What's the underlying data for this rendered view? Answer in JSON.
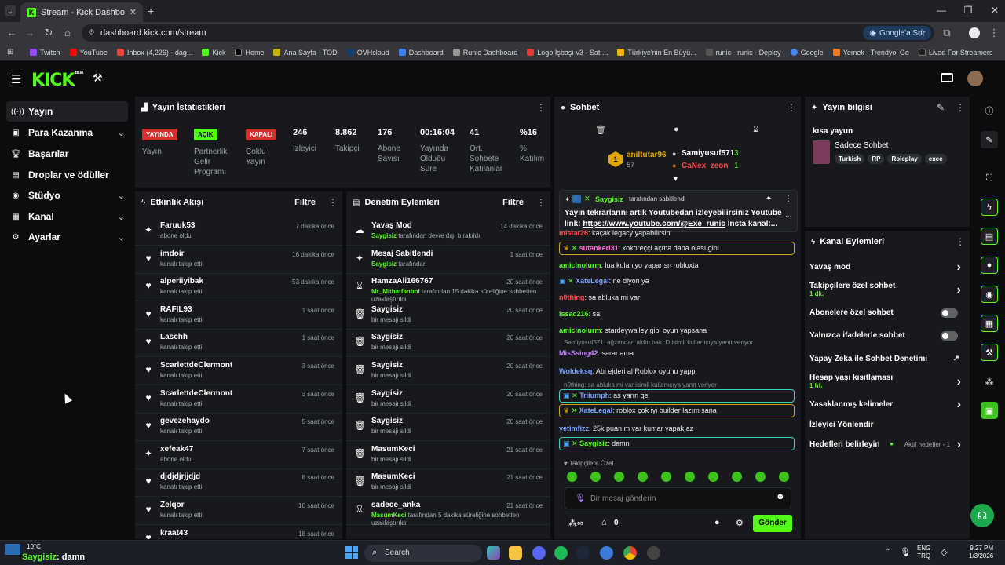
{
  "browser": {
    "tab_title": "Stream - Kick Dashboard",
    "url": "dashboard.kick.com/stream",
    "google_ask": "Google'a Sor",
    "bookmarks": [
      "Twitch",
      "YouTube",
      "Inbox (4,226) - dag...",
      "Kick",
      "Home",
      "Ana Sayfa - TOD",
      "OVHcloud",
      "Dashboard",
      "Runic Dashboard",
      "Logo İşbaşı v3 - Satı...",
      "Türkiye'nin En Büyü...",
      "runic - runic - Deploy",
      "Google",
      "Yemek - Trendyol Go",
      "Livad For Streamers"
    ]
  },
  "brand": {
    "logo": "KICK",
    "beta": "BETA",
    "accent": "#53fc18"
  },
  "sidebar": {
    "items": [
      {
        "label": "Yayın",
        "icon": "broadcast-icon"
      },
      {
        "label": "Para Kazanma",
        "icon": "money-icon"
      },
      {
        "label": "Başarılar",
        "icon": "trophy-icon"
      },
      {
        "label": "Droplar ve ödüller",
        "icon": "gift-icon"
      },
      {
        "label": "Stüdyo",
        "icon": "studio-icon"
      },
      {
        "label": "Kanal",
        "icon": "channel-icon"
      },
      {
        "label": "Ayarlar",
        "icon": "gear-icon"
      }
    ]
  },
  "stats": {
    "title": "Yayın İstatistikleri",
    "status": [
      {
        "badge": "YAYINDA",
        "label": "Yayın"
      },
      {
        "badge": "AÇIK",
        "label": "Partnerlik Gelir Programı"
      },
      {
        "badge": "KAPALI",
        "label": "Çoklu Yayın"
      }
    ],
    "metrics": [
      {
        "value": "246",
        "label": "İzleyici"
      },
      {
        "value": "8.862",
        "label": "Takipçi"
      },
      {
        "value": "176",
        "label": "Abone Sayısı"
      },
      {
        "value": "00:16:04",
        "label": "Yayında Olduğu Süre"
      },
      {
        "value": "41",
        "label": "Ort. Sohbete Katılanlar"
      },
      {
        "value": "%16",
        "label": "% Katılım"
      }
    ]
  },
  "activity": {
    "title": "Etkinlik Akışı",
    "filter": "Filtre",
    "rows": [
      {
        "name": "Faruuk53",
        "sub": "abone oldu",
        "time": "7 dakika önce",
        "icon": "sparkle"
      },
      {
        "name": "imdoir",
        "sub": "kanalı takip etti",
        "time": "16 dakika önce",
        "icon": "heart"
      },
      {
        "name": "alperiiyibak",
        "sub": "kanalı takip etti",
        "time": "53 dakika önce",
        "icon": "heart"
      },
      {
        "name": "RAFIL93",
        "sub": "kanalı takip etti",
        "time": "1 saat önce",
        "icon": "heart"
      },
      {
        "name": "Laschh",
        "sub": "kanalı takip etti",
        "time": "1 saat önce",
        "icon": "heart"
      },
      {
        "name": "ScarlettdeClermont",
        "sub": "kanalı takip etti",
        "time": "3 saat önce",
        "icon": "heart"
      },
      {
        "name": "ScarlettdeClermont",
        "sub": "kanalı takip etti",
        "time": "3 saat önce",
        "icon": "heart"
      },
      {
        "name": "gevezehaydo",
        "sub": "kanalı takip etti",
        "time": "5 saat önce",
        "icon": "heart"
      },
      {
        "name": "xefeak47",
        "sub": "abone oldu",
        "time": "7 saat önce",
        "icon": "sparkle"
      },
      {
        "name": "djdjdjrjjdjd",
        "sub": "kanalı takip etti",
        "time": "8 saat önce",
        "icon": "heart"
      },
      {
        "name": "Zelqor",
        "sub": "kanalı takip etti",
        "time": "10 saat önce",
        "icon": "heart"
      },
      {
        "name": "kraat43",
        "sub": "",
        "time": "18 saat önce",
        "icon": "heart"
      }
    ]
  },
  "moderation": {
    "title": "Denetim Eylemleri",
    "filter": "Filtre",
    "rows": [
      {
        "name": "Yavaş Mod",
        "actor": "Saygisiz",
        "sub": " tarafından devre dışı bırakıldı",
        "time": "14 dakika önce",
        "icon": "slow"
      },
      {
        "name": "Mesaj Sabitlendi",
        "actor": "Saygisiz",
        "sub": " tarafından",
        "time": "1 saat önce",
        "icon": "pin"
      },
      {
        "name": "HamzaAli166767",
        "actor": "Mr_Mithatfanboi",
        "sub": " tarafından 15 dakika süreliğine sohbetten uzaklaştırıldı",
        "time": "20 saat önce",
        "icon": "hourglass"
      },
      {
        "name": "Saygisiz",
        "actor": "",
        "sub": "bir mesajı sildi",
        "time": "20 saat önce",
        "icon": "trash"
      },
      {
        "name": "Saygisiz",
        "actor": "",
        "sub": "bir mesajı sildi",
        "time": "20 saat önce",
        "icon": "trash"
      },
      {
        "name": "Saygisiz",
        "actor": "",
        "sub": "bir mesajı sildi",
        "time": "20 saat önce",
        "icon": "trash"
      },
      {
        "name": "Saygisiz",
        "actor": "",
        "sub": "bir mesajı sildi",
        "time": "20 saat önce",
        "icon": "trash"
      },
      {
        "name": "Saygisiz",
        "actor": "",
        "sub": "bir mesajı sildi",
        "time": "20 saat önce",
        "icon": "trash"
      },
      {
        "name": "MasumKeci",
        "actor": "",
        "sub": "bir mesajı sildi",
        "time": "21 saat önce",
        "icon": "trash"
      },
      {
        "name": "MasumKeci",
        "actor": "",
        "sub": "bir mesajı sildi",
        "time": "21 saat önce",
        "icon": "trash"
      },
      {
        "name": "sadece_anka",
        "actor": "MasumKeci",
        "sub": " tarafından 5 dakika süreliğine sohbetten uzaklaştırıldı",
        "time": "21 saat önce",
        "icon": "hourglass"
      }
    ]
  },
  "chat": {
    "title": "Sohbet",
    "leaderboard": [
      {
        "rank": "1",
        "name": "aniltutar96",
        "count": "57"
      },
      {
        "rank": "",
        "name": "Samiyusuf571",
        "count": "3"
      },
      {
        "rank": "",
        "name": "CaNex_zeon",
        "count": "1"
      }
    ],
    "pinned": {
      "by": "Saygisiz",
      "by_suffix": "tarafından sabitlendi",
      "text_1": "Yayın tekrarlarını artık Youtubedan izleyebilirsiniz Youtube",
      "text_2_prefix": "link: ",
      "link": "https://www.youtube.com/@Exe_runic",
      "text_2_suffix": " İnsta kanal:..."
    },
    "messages": [
      {
        "user": "mistar26",
        "color": "#ff4b4b",
        "text": "kaçak legacy yapabilirsin",
        "style": "plain",
        "reply": ""
      },
      {
        "user": "sutankeri31",
        "color": "#ff6ad5",
        "text": "kokoreççi açma daha olası gibi",
        "style": "gold",
        "reply": ""
      },
      {
        "user": "amicinolurm",
        "color": "#53fc18",
        "text": "lua kulaniyo yaparısn robloxta",
        "style": "plain",
        "reply": ""
      },
      {
        "user": "XateLegal",
        "color": "#7aa2ff",
        "text": "ne diyon ya",
        "style": "plain-badge",
        "reply": ""
      },
      {
        "user": "n0thing",
        "color": "#ff4b4b",
        "text": "sa abluka mi var",
        "style": "plain",
        "reply": ""
      },
      {
        "user": "issac216",
        "color": "#53fc18",
        "text": "sa",
        "style": "plain",
        "reply": ""
      },
      {
        "user": "amicinolurm",
        "color": "#53fc18",
        "text": "stardeywalley gibi oyun yapsana",
        "style": "plain",
        "reply": ""
      },
      {
        "user": "MisSsing42",
        "color": "#c77dff",
        "text": "sarar ama",
        "style": "plain",
        "reply": "Samiyusuf571: ağzımdan aldın bak :D isimli kullanıcıya yanıt veriyor"
      },
      {
        "user": "Woldeksq",
        "color": "#7aa2ff",
        "text": "Abi ejderi al Roblox oyunu yapp",
        "style": "plain",
        "reply": ""
      },
      {
        "user": "Triiumph",
        "color": "#7aa2ff",
        "text": "as yarın gel",
        "style": "cyan",
        "reply": "n0thing: sa abluka mi var isimli kullanıcıya yanıt veriyor"
      },
      {
        "user": "XateLegal",
        "color": "#7aa2ff",
        "text": "roblox çok iyi builder lazım sana",
        "style": "gold",
        "reply": ""
      },
      {
        "user": "yetimfizz",
        "color": "#7aa2ff",
        "text": "25k puanım var kumar yapak az",
        "style": "plain",
        "reply": ""
      },
      {
        "user": "Saygisiz",
        "color": "#53fc18",
        "text": "damn",
        "style": "cyan",
        "reply": ""
      }
    ],
    "emote_label": "Takipçilere Özel",
    "input_placeholder": "Bir mesaj gönderin",
    "points": "0",
    "send": "Gönder"
  },
  "stream_info": {
    "title": "Yayın bilgisi",
    "stream_title": "kısa yayun",
    "category": "Sadece Sohbet",
    "tags": [
      "Turkish",
      "RP",
      "Roleplay",
      "exee"
    ]
  },
  "channel_actions": {
    "title": "Kanal Eylemleri",
    "items": [
      {
        "label": "Yavaş mod",
        "sub": "",
        "control": "chevron"
      },
      {
        "label": "Takipçilere özel sohbet",
        "sub": "1 dk.",
        "control": "chevron"
      },
      {
        "label": "Abonelere özel sohbet",
        "sub": "",
        "control": "toggle"
      },
      {
        "label": "Yalnızca ifadelerle sohbet",
        "sub": "",
        "control": "toggle"
      },
      {
        "label": "Yapay Zeka ile Sohbet Denetimi",
        "sub": "",
        "control": "external"
      },
      {
        "label": "Hesap yaşı kısıtlaması",
        "sub": "1 hf.",
        "control": "chevron"
      },
      {
        "label": "Yasaklanmış kelimeler",
        "sub": "",
        "control": "chevron"
      },
      {
        "label": "İzleyici Yönlendir",
        "sub": "",
        "control": "none"
      },
      {
        "label": "Hedefleri belirleyin",
        "sub": "",
        "control": "chevron"
      }
    ],
    "goals_status": "Aktif hedefler - 1"
  },
  "taskbar": {
    "weather_temp": "10°C",
    "notification_user": "Saygisiz",
    "notification_text": ": damn",
    "search": "Search",
    "lang_1": "ENG",
    "lang_2": "TRQ",
    "time": "9:27 PM",
    "date": "1/3/2026"
  }
}
